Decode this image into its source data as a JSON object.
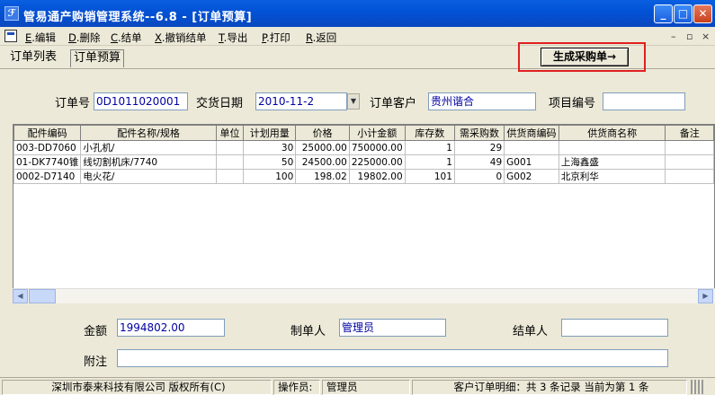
{
  "window": {
    "title": "管易通产购销管理系统--6.8 - [订单预算]",
    "icon": "app-feather-icon"
  },
  "menu": {
    "items": [
      {
        "key": "E",
        "label": ".编辑"
      },
      {
        "key": "D",
        "label": ".删除"
      },
      {
        "key": "C",
        "label": ".结单"
      },
      {
        "key": "X",
        "label": ".撤销结单"
      },
      {
        "key": "T",
        "label": ".导出"
      },
      {
        "key": "P",
        "label": ".打印"
      },
      {
        "key": "R",
        "label": ".返回"
      }
    ],
    "mdi_controls": [
      "–",
      "▫",
      "×"
    ]
  },
  "tabs": [
    {
      "label": "订单列表"
    },
    {
      "label": "订单预算"
    }
  ],
  "generate_button": "生成采购单→",
  "highlight_color": "#e02020",
  "form": {
    "order_no_label": "订单号",
    "order_no": "0D1011020001",
    "delivery_date_label": "交货日期",
    "delivery_date": "2010-11-2",
    "customer_label": "订单客户",
    "customer": "贵州谐合",
    "project_label": "项目编号",
    "project": ""
  },
  "table": {
    "columns": [
      "配件编码",
      "配件名称/规格",
      "单位",
      "计划用量",
      "价格",
      "小计金额",
      "库存数",
      "需采购数",
      "供货商编码",
      "供货商名称",
      "备注"
    ],
    "rows": [
      [
        "003-DD7060",
        "小孔机/",
        "",
        "30",
        "25000.00",
        "750000.00",
        "1",
        "29",
        "",
        "",
        ""
      ],
      [
        "01-DK7740锥",
        "线切割机床/7740",
        "",
        "50",
        "24500.00",
        "225000.00",
        "1",
        "49",
        "G001",
        "上海鑫盛",
        ""
      ],
      [
        "0002-D7140",
        "电火花/",
        "",
        "100",
        "198.02",
        "19802.00",
        "101",
        "0",
        "G002",
        "北京利华",
        ""
      ]
    ]
  },
  "footer": {
    "amount_label": "金额",
    "amount": "1994802.00",
    "creator_label": "制单人",
    "creator": "管理员",
    "closer_label": "结单人",
    "closer": "",
    "note_label": "附注",
    "note": ""
  },
  "status": {
    "company": "深圳市泰来科技有限公司 版权所有(C)",
    "operator_label": "操作员:",
    "operator": "管理员",
    "record_info": "客户订单明细：共 3 条记录 当前为第 1 条"
  }
}
